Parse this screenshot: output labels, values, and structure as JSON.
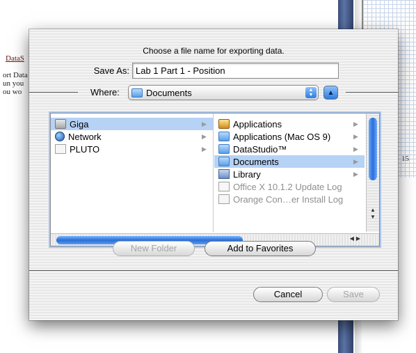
{
  "background": {
    "doc_title": "DataS",
    "doc_lines": [
      "ort Data",
      "un you",
      "ou wo"
    ],
    "axis_label": "15"
  },
  "dialog": {
    "prompt": "Choose a file name for exporting data.",
    "save_as_label": "Save As:",
    "save_as_value": "Lab 1 Part 1 - Position",
    "where_label": "Where:",
    "where_value": "Documents"
  },
  "browser": {
    "column1": [
      {
        "label": "Giga",
        "icon": "hard-disk-icon",
        "selected": true
      },
      {
        "label": "Network",
        "icon": "network-globe-icon",
        "selected": false
      },
      {
        "label": "PLUTO",
        "icon": "disk-icon",
        "selected": false
      }
    ],
    "column2": [
      {
        "label": "Applications",
        "icon": "applications-folder-icon",
        "selected": false,
        "dimmed": false
      },
      {
        "label": "Applications (Mac OS 9)",
        "icon": "folder-icon",
        "selected": false,
        "dimmed": false
      },
      {
        "label": "DataStudio™",
        "icon": "folder-icon",
        "selected": false,
        "dimmed": false
      },
      {
        "label": "Documents",
        "icon": "folder-icon",
        "selected": true,
        "dimmed": false
      },
      {
        "label": "Library",
        "icon": "library-folder-icon",
        "selected": false,
        "dimmed": false
      },
      {
        "label": "Office X 10.1.2 Update Log",
        "icon": "document-icon",
        "selected": false,
        "dimmed": true
      },
      {
        "label": "Orange Con…er Install Log",
        "icon": "document-icon",
        "selected": false,
        "dimmed": true
      }
    ]
  },
  "buttons": {
    "new_folder": "New Folder",
    "add_to_favorites": "Add to Favorites",
    "cancel": "Cancel",
    "save": "Save"
  }
}
